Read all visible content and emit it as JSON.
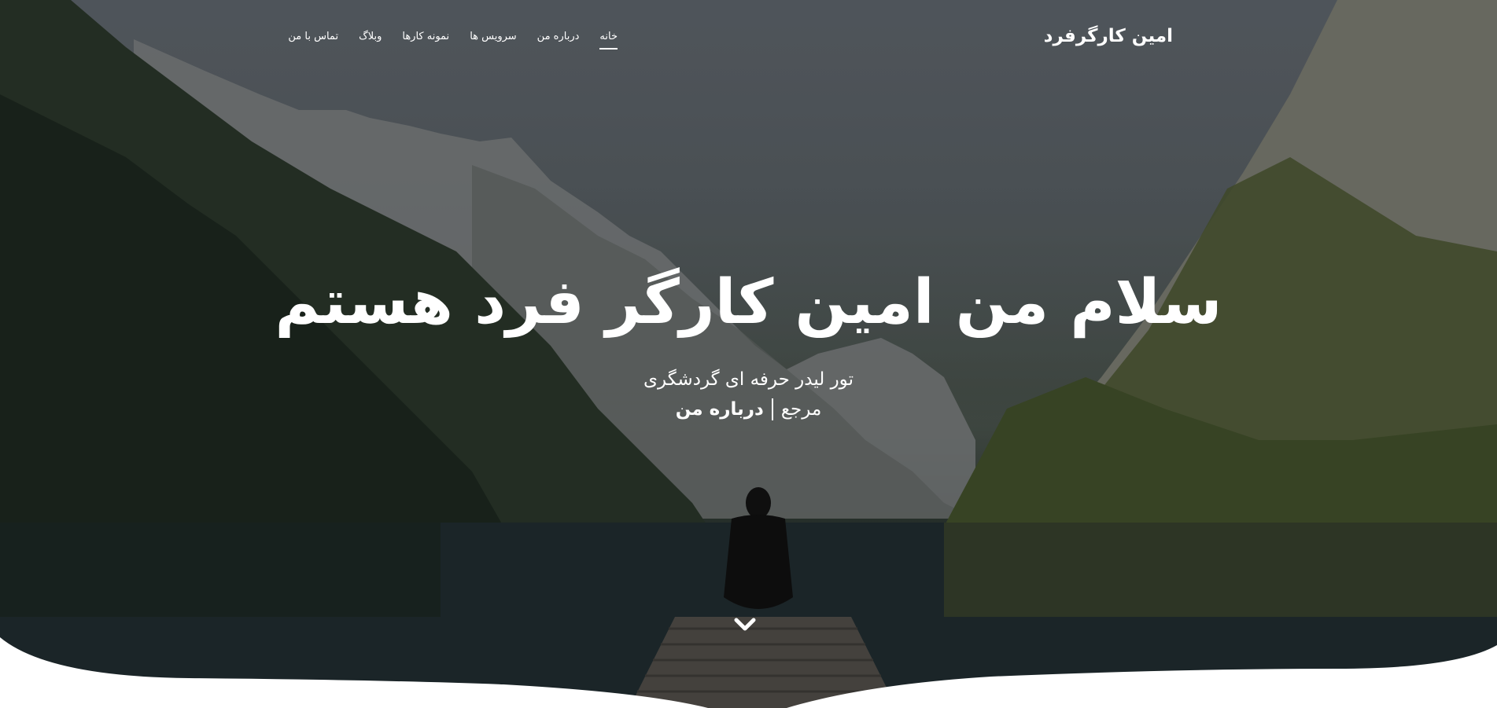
{
  "header": {
    "brand": "امین کارگرفرد"
  },
  "nav": {
    "items": [
      {
        "label": "خانه",
        "active": true
      },
      {
        "label": "درباره من",
        "active": false
      },
      {
        "label": "سرویس ها",
        "active": false
      },
      {
        "label": "نمونه کارها",
        "active": false
      },
      {
        "label": "وبلاگ",
        "active": false
      },
      {
        "label": "تماس با من",
        "active": false
      }
    ]
  },
  "hero": {
    "title": "سلام من امین کارگر فرد هستم",
    "subtitle": "تور لیدر حرفه ای گردشگری",
    "reference_label": "مرجع",
    "reference_link": "درباره من"
  },
  "icons": {
    "scroll_down": "chevron-down-icon"
  },
  "colors": {
    "text": "#ffffff",
    "background": "#ffffff"
  }
}
